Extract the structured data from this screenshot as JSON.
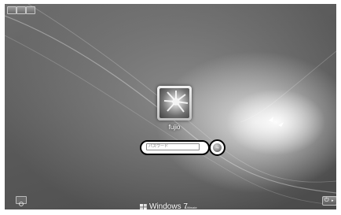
{
  "login": {
    "username": "fujio",
    "password_placeholder": "パスワード",
    "submit_arrow": "→"
  },
  "branding": {
    "product": "Windows 7",
    "edition": "Ultimate"
  },
  "icons": {
    "ease_of_access": "ease-of-access-icon",
    "power": "power-icon",
    "submit": "arrow-right-icon",
    "windows_logo": "windows-logo-icon"
  },
  "power_button": {
    "symbol": "⏻",
    "arrow": "▸"
  }
}
